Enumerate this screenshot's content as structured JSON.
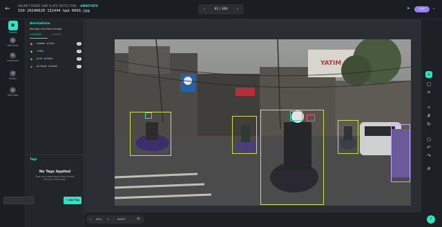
{
  "header": {
    "breadcrumb": [
      "HELMET RIDER AND PLATE DETECTION",
      "ANNOTATE"
    ],
    "filename": "ISO 20240620 132444 hpd 0669.jpg",
    "pager": {
      "prev": "‹",
      "count": "61 / 300",
      "next": "›"
    },
    "flag_icon": "flag-icon",
    "user_pill": "SAVE",
    "menu_caret": "⌄"
  },
  "rail": [
    {
      "key": "classes",
      "label": "Classes",
      "icon": "●",
      "active": true
    },
    {
      "key": "attributes",
      "label": "Attributes",
      "icon": "◎",
      "active": false
    },
    {
      "key": "comments",
      "label": "Comments",
      "icon": "✎",
      "active": false
    },
    {
      "key": "history",
      "label": "History",
      "icon": "↺",
      "active": false
    },
    {
      "key": "raw_data",
      "label": "Raw Data",
      "icon": "≡",
      "active": false
    }
  ],
  "panel": {
    "title": "Annotations",
    "subtitle": "Manage Individual Image",
    "tabs": [
      "CLASSES",
      "LAYERS"
    ],
    "classes": [
      {
        "name": "number plate",
        "color": "#c9a4ff",
        "count": "1"
      },
      {
        "name": "rider",
        "color": "#c9e14a",
        "count": "5"
      },
      {
        "name": "with helmet",
        "color": "#2fe3c3",
        "count": "4"
      },
      {
        "name": "without helmet",
        "color": "#ff4f7a",
        "count": "1"
      }
    ],
    "tags": {
      "title": "Tags",
      "empty_title": "No Tags Applied",
      "empty_help": "Type and select tags below to add them to this image.",
      "input_placeholder": "",
      "add_label": "+ Add Tag"
    }
  },
  "tools": [
    "cursor-icon",
    "box-icon",
    "polygon-icon",
    "brush-icon",
    "magic-icon",
    "smart-icon",
    "comment-icon",
    "undo-icon",
    "redo-icon",
    "hide-icon"
  ],
  "bottom": {
    "arrow_left": "←",
    "zoom": "50%",
    "mode_icon": "↗",
    "separator": "·",
    "mode_label": "RIGHT",
    "circle_icon": "◎",
    "help_icon": "?"
  },
  "colors": {
    "accent": "#2fe3c3",
    "rider": "#c9e14a",
    "plate": "#9b7cff"
  }
}
